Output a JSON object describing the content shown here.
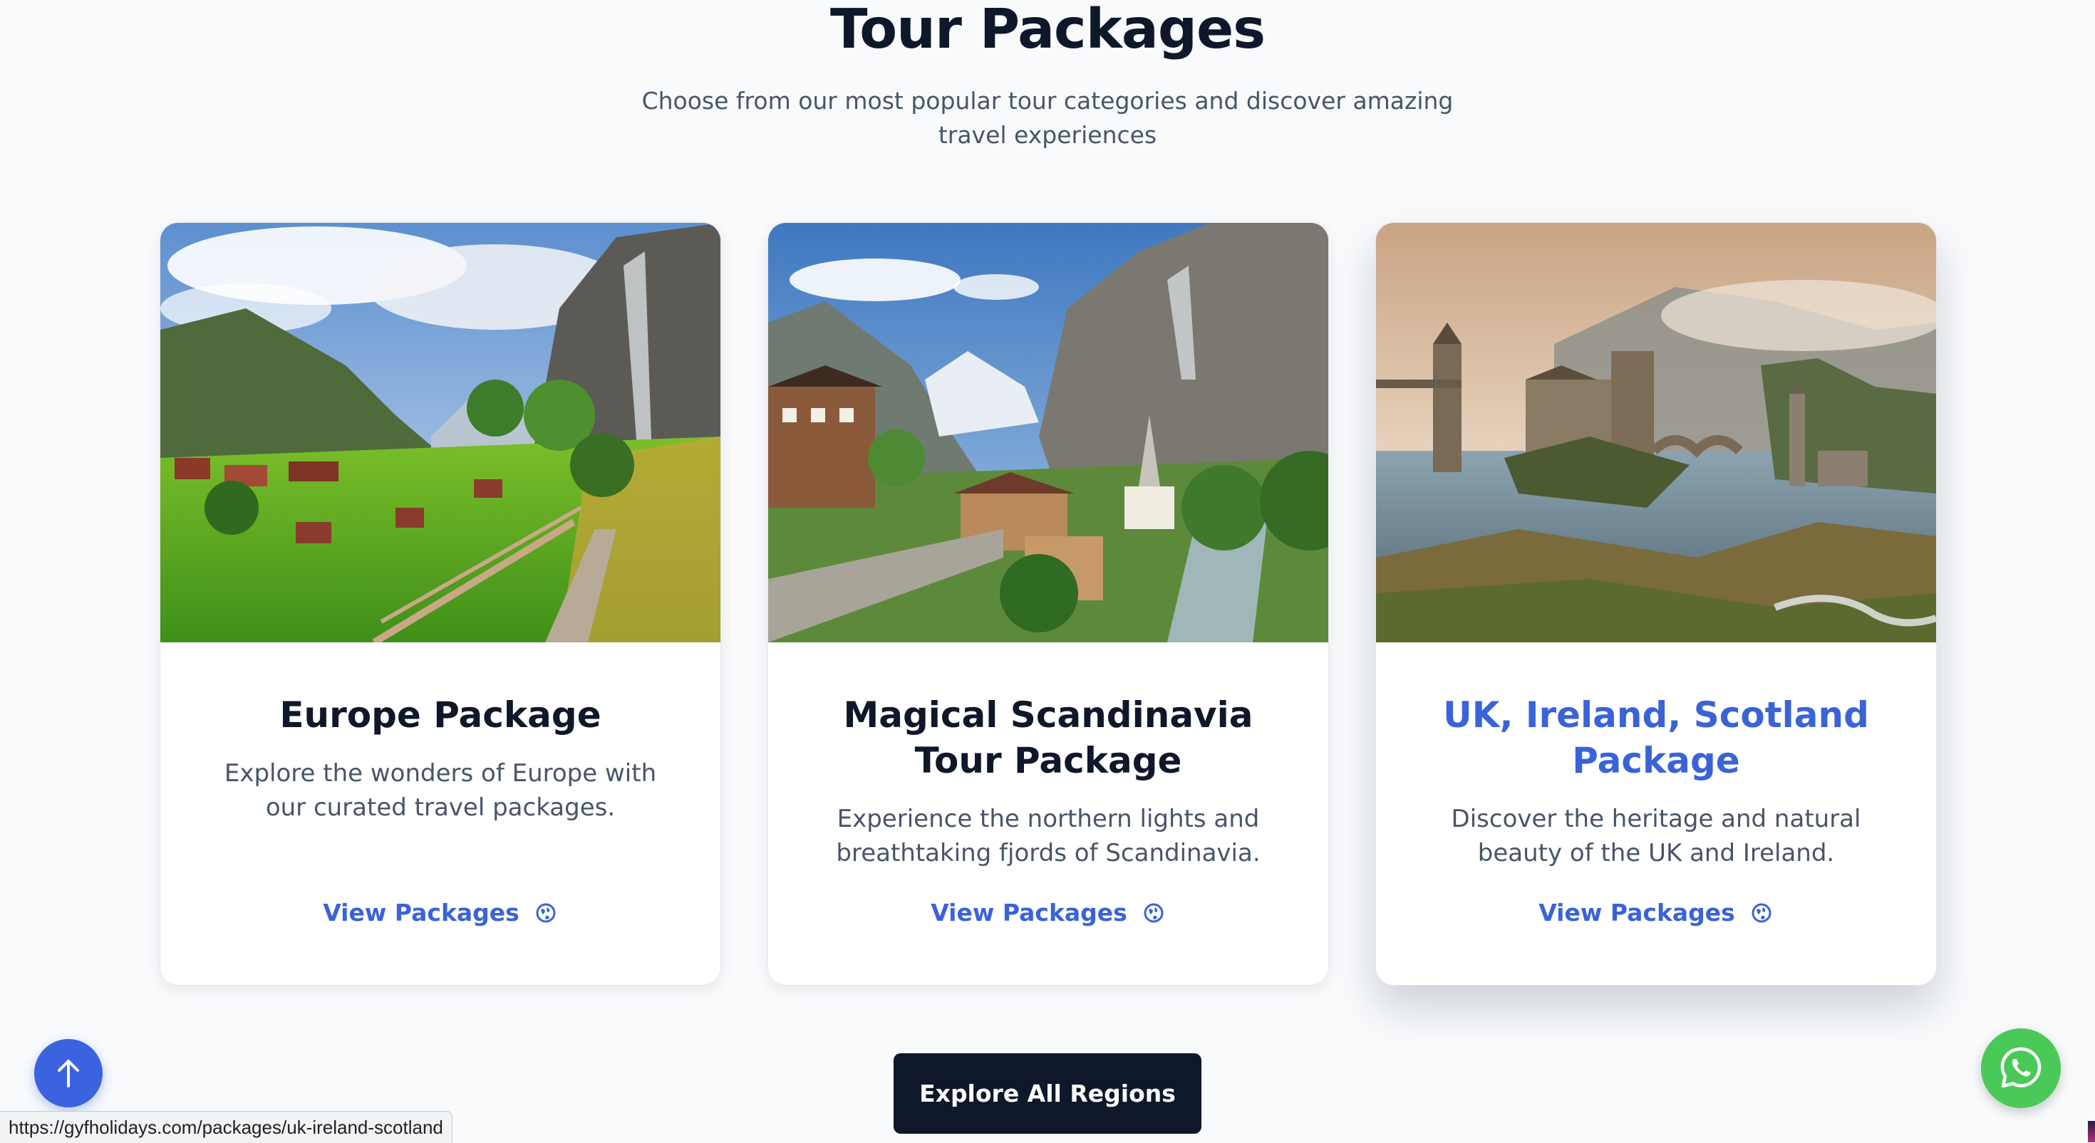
{
  "section": {
    "title": "Tour Packages",
    "subtitle": "Choose from our most popular tour categories and discover amazing travel experiences"
  },
  "cards": [
    {
      "title": "Europe Package",
      "description": "Explore the wonders of Europe with our curated travel packages.",
      "link_label": "View Packages",
      "icon": "globe-icon"
    },
    {
      "title": "Magical Scandinavia Tour Package",
      "description": "Experience the northern lights and breathtaking fjords of Scandinavia.",
      "link_label": "View Packages",
      "icon": "globe-icon"
    },
    {
      "title": "UK, Ireland, Scotland Package",
      "description": "Discover the heritage and natural beauty of the UK and Ireland.",
      "link_label": "View Packages",
      "icon": "globe-icon"
    }
  ],
  "explore_button": {
    "label": "Explore All Regions"
  },
  "status_bar": {
    "url": "https://gyfholidays.com/packages/uk-ireland-scotland"
  },
  "floating": {
    "scroll_top_icon": "arrow-up-icon",
    "whatsapp_icon": "whatsapp-icon"
  },
  "colors": {
    "accent": "#3a63d8",
    "dark": "#0f172a",
    "whatsapp": "#4ac959",
    "background": "#f8fafc"
  }
}
